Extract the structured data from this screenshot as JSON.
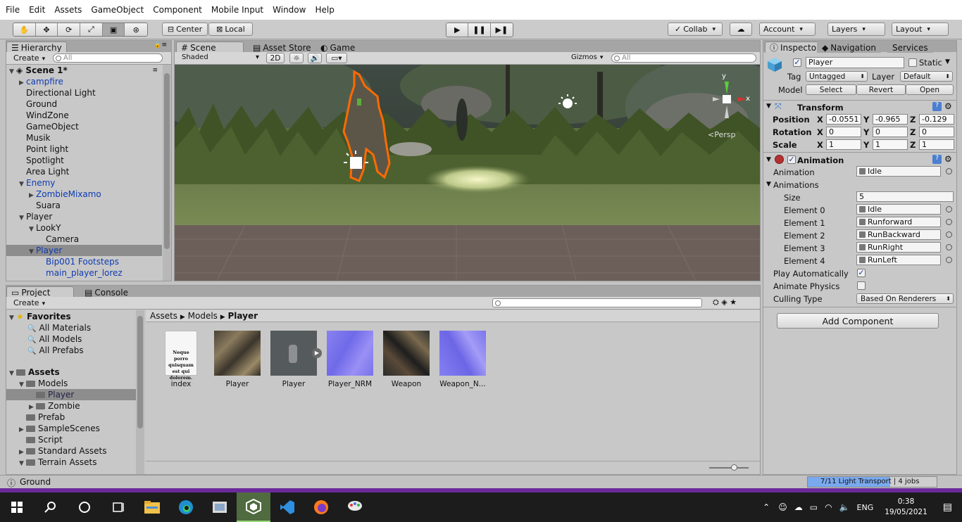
{
  "menu": [
    "File",
    "Edit",
    "Assets",
    "GameObject",
    "Component",
    "Mobile Input",
    "Window",
    "Help"
  ],
  "toolbar": {
    "pivot": "Center",
    "space": "Local",
    "collab": "Collab",
    "account": "Account",
    "layers": "Layers",
    "layout": "Layout"
  },
  "hierarchy": {
    "tab": "Hierarchy",
    "create": "Create",
    "search_placeholder": "All",
    "scene": "Scene 1*",
    "items": [
      {
        "label": "campfire",
        "depth": 1,
        "arrow": "▶",
        "style": "blue"
      },
      {
        "label": "Directional Light",
        "depth": 1,
        "arrow": "",
        "style": ""
      },
      {
        "label": "Ground",
        "depth": 1,
        "arrow": "",
        "style": ""
      },
      {
        "label": "WindZone",
        "depth": 1,
        "arrow": "",
        "style": ""
      },
      {
        "label": "GameObject",
        "depth": 1,
        "arrow": "",
        "style": ""
      },
      {
        "label": "Musik",
        "depth": 1,
        "arrow": "",
        "style": ""
      },
      {
        "label": "Point light",
        "depth": 1,
        "arrow": "",
        "style": ""
      },
      {
        "label": "Spotlight",
        "depth": 1,
        "arrow": "",
        "style": ""
      },
      {
        "label": "Area Light",
        "depth": 1,
        "arrow": "",
        "style": ""
      },
      {
        "label": "Enemy",
        "depth": 1,
        "arrow": "▼",
        "style": "blue"
      },
      {
        "label": "ZombieMixamo",
        "depth": 2,
        "arrow": "▶",
        "style": "blue"
      },
      {
        "label": "Suara",
        "depth": 2,
        "arrow": "",
        "style": ""
      },
      {
        "label": "Player",
        "depth": 1,
        "arrow": "▼",
        "style": ""
      },
      {
        "label": "LookY",
        "depth": 2,
        "arrow": "▼",
        "style": ""
      },
      {
        "label": "Camera",
        "depth": 3,
        "arrow": "",
        "style": ""
      },
      {
        "label": "Player",
        "depth": 2,
        "arrow": "▼",
        "style": "blue sel"
      },
      {
        "label": "Bip001 Footsteps",
        "depth": 3,
        "arrow": "",
        "style": "blue"
      },
      {
        "label": "main_player_lorez",
        "depth": 3,
        "arrow": "",
        "style": "blue"
      }
    ]
  },
  "scene": {
    "tabs": [
      "Scene",
      "Asset Store",
      "Game"
    ],
    "shading": "Shaded",
    "mode2d": "2D",
    "gizmos": "Gizmos",
    "search_placeholder": "All",
    "persp": "Persp",
    "axis_y": "y",
    "axis_x": "x"
  },
  "project": {
    "tabs": [
      "Project",
      "Console"
    ],
    "create": "Create",
    "breadcrumb": [
      "Assets",
      "Models",
      "Player"
    ],
    "favorites_title": "Favorites",
    "favorites": [
      "All Materials",
      "All Models",
      "All Prefabs"
    ],
    "assets_title": "Assets",
    "tree": [
      {
        "label": "Models",
        "arrow": "▼",
        "depth": 1
      },
      {
        "label": "Player",
        "arrow": "",
        "depth": 2,
        "sel": true
      },
      {
        "label": "Zombie",
        "arrow": "▶",
        "depth": 2
      },
      {
        "label": "Prefab",
        "arrow": "",
        "depth": 1
      },
      {
        "label": "SampleScenes",
        "arrow": "▶",
        "depth": 1
      },
      {
        "label": "Script",
        "arrow": "",
        "depth": 1
      },
      {
        "label": "Standard Assets",
        "arrow": "▶",
        "depth": 1
      },
      {
        "label": "Terrain Assets",
        "arrow": "▼",
        "depth": 1
      }
    ],
    "assets": [
      "index",
      "Player",
      "Player",
      "Player_NRM",
      "Weapon",
      "Weapon_N..."
    ],
    "doc_text": "Neque porro quisquam est qui dolorem."
  },
  "inspector": {
    "tabs": [
      "Inspector",
      "Navigation",
      "Services"
    ],
    "name": "Player",
    "static": "Static",
    "tag_label": "Tag",
    "tag": "Untagged",
    "layer_label": "Layer",
    "layer": "Default",
    "model_label": "Model",
    "model_buttons": [
      "Select",
      "Revert",
      "Open"
    ],
    "transform_title": "Transform",
    "position_label": "Position",
    "rotation_label": "Rotation",
    "scale_label": "Scale",
    "position": [
      "-0.0551",
      "-0.965",
      "-0.129"
    ],
    "rotation": [
      "0",
      "0",
      "0"
    ],
    "scale": [
      "1",
      "1",
      "1"
    ],
    "animation_title": "Animation",
    "animation_label": "Animation",
    "animation_value": "Idle",
    "animations_label": "Animations",
    "size_label": "Size",
    "size": "5",
    "elements": [
      {
        "label": "Element 0",
        "value": "Idle"
      },
      {
        "label": "Element 1",
        "value": "Runforward"
      },
      {
        "label": "Element 2",
        "value": "RunBackward"
      },
      {
        "label": "Element 3",
        "value": "RunRight"
      },
      {
        "label": "Element 4",
        "value": "RunLeft"
      }
    ],
    "play_auto": "Play Automatically",
    "animate_physics": "Animate Physics",
    "culling_label": "Culling Type",
    "culling_value": "Based On Renderers",
    "add_component": "Add Component"
  },
  "status": {
    "message": "Ground",
    "progress_text": "7/11 Light Transport | 4 jobs",
    "progress_fraction": 0.64
  },
  "taskbar": {
    "lang": "ENG",
    "time": "0:38",
    "date": "19/05/2021"
  },
  "colors": {
    "unity_bg": "#c2c2c2",
    "selection": "#8d8d8d",
    "blue_text": "#0f3bb3",
    "taskbar": "#1c1c1c",
    "outline": "#ff6a00"
  }
}
